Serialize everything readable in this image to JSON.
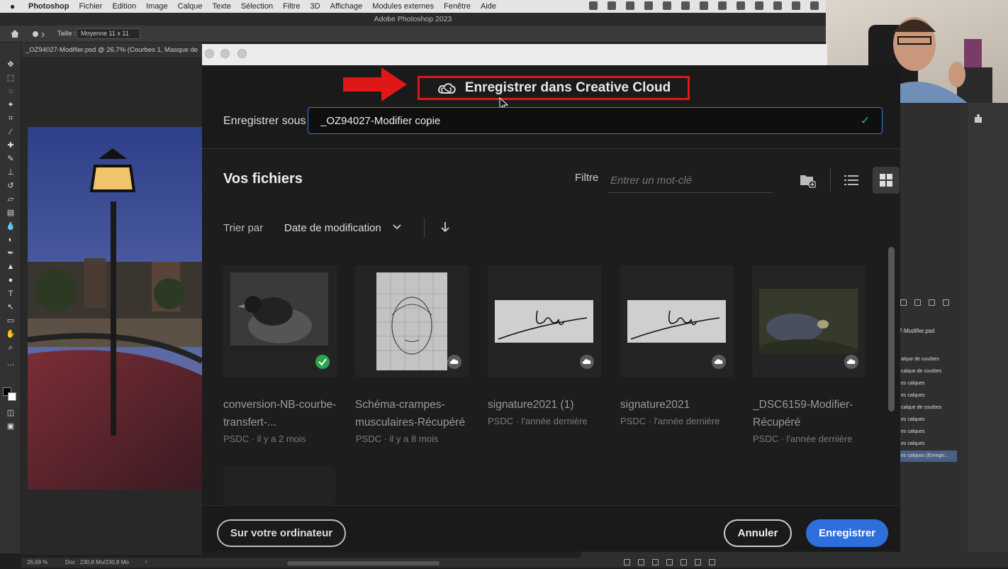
{
  "menubar": {
    "items": [
      "Photoshop",
      "Fichier",
      "Edition",
      "Image",
      "Calque",
      "Texte",
      "Sélection",
      "Filtre",
      "3D",
      "Affichage",
      "Modules externes",
      "Fenêtre",
      "Aide"
    ]
  },
  "app_title": "Adobe Photoshop 2023",
  "options": {
    "size_label": "Taille :",
    "size_value": "Moyenne 11 x 11"
  },
  "document_tab": "_OZ94027-Modifier.psd @ 26,7% (Courbes 1, Masque de",
  "statusbar": {
    "zoom": "26,69 %",
    "doc": "Doc : 230,8 Mo/230,8 Mo",
    "arrow": "›"
  },
  "layers": {
    "doc_name": "7-Modifier.psd",
    "rows": [
      "alque de courbes",
      "calque de courbes",
      "es calques",
      "es calques",
      "calque de courbes",
      "es calques",
      "es calques",
      "es calques",
      "es calques (Enregis..."
    ]
  },
  "dialog": {
    "title": "Enregistrer dans Creative Cloud",
    "save_as_label": "Enregistrer sous",
    "save_as_value": "_OZ94027-Modifier copie",
    "files_title": "Vos fichiers",
    "filter_label": "Filtre",
    "filter_placeholder": "Entrer un mot-clé",
    "sort_label": "Trier par",
    "sort_value": "Date de modification",
    "files": [
      {
        "name": "conversion-NB-courbe-transfert-...",
        "meta": "PSDC · il y a 2 mois",
        "status": "synced"
      },
      {
        "name": "Schéma-crampes-musculaires-Récupéré",
        "meta": "PSDC · il y a 8 mois",
        "status": "cloud"
      },
      {
        "name": "signature2021 (1)",
        "meta": "PSDC · l'année dernière",
        "status": "cloud"
      },
      {
        "name": "signature2021",
        "meta": "PSDC · l'année dernière",
        "status": "cloud"
      },
      {
        "name": "_DSC6159-Modifier-Récupéré",
        "meta": "PSDC · l'année dernière",
        "status": "cloud"
      }
    ],
    "buttons": {
      "local": "Sur votre ordinateur",
      "cancel": "Annuler",
      "save": "Enregistrer"
    }
  },
  "colors": {
    "accent": "#2f6fdb",
    "highlight_red": "#e01717",
    "ok_green": "#2da44e"
  },
  "icons": [
    "apple-icon",
    "home-icon",
    "brush-icon",
    "creative-cloud-icon",
    "check-icon",
    "new-folder-icon",
    "list-view-icon",
    "grid-view-icon",
    "chevron-down-icon",
    "arrow-down-icon",
    "cloud-icon"
  ]
}
